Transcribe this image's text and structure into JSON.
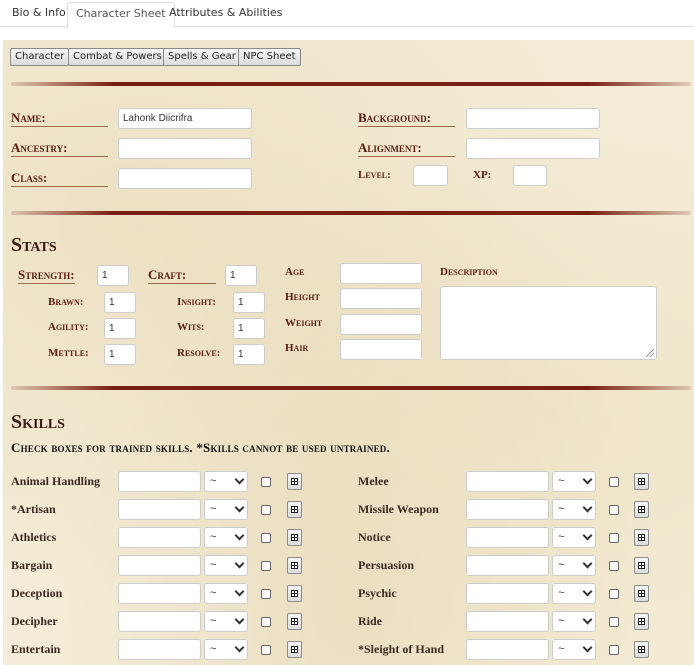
{
  "tabs": [
    "Bio & Info",
    "Character Sheet",
    "Attributes & Abilities"
  ],
  "nav_buttons": [
    "Character",
    "Combat & Powers",
    "Spells & Gear",
    "NPC Sheet"
  ],
  "character": {
    "name_label": "Name:",
    "name_value": "Lahonk Diicrifra",
    "ancestry_label": "Ancestry:",
    "class_label": "Class:",
    "background_label": "Background:",
    "alignment_label": "Alignment:",
    "level_label": "Level:",
    "xp_label": "XP:"
  },
  "stats": {
    "title": "Stats",
    "strength_label": "Strength:",
    "strength_value": "1",
    "craft_label": "Craft:",
    "craft_value": "1",
    "brawn_label": "Brawn:",
    "brawn_value": "1",
    "agility_label": "Agility:",
    "agility_value": "1",
    "mettle_label": "Mettle:",
    "mettle_value": "1",
    "insight_label": "Insight:",
    "insight_value": "1",
    "wits_label": "Wits:",
    "wits_value": "1",
    "resolve_label": "Resolve:",
    "resolve_value": "1",
    "age_label": "Age",
    "height_label": "Height",
    "weight_label": "Weight",
    "hair_label": "Hair",
    "description_label": "Description"
  },
  "skills": {
    "title": "Skills",
    "note": "Check boxes for trained skills. *Skills cannot be used untrained.",
    "select_value": "~",
    "left": [
      "Animal Handling",
      "*Artisan",
      "Athletics",
      "Bargain",
      "Deception",
      "Decipher",
      "Entertain"
    ],
    "right": [
      "Melee",
      "Missile Weapon",
      "Notice",
      "Persuasion",
      "Psychic",
      "Ride",
      "*Sleight of Hand"
    ]
  }
}
